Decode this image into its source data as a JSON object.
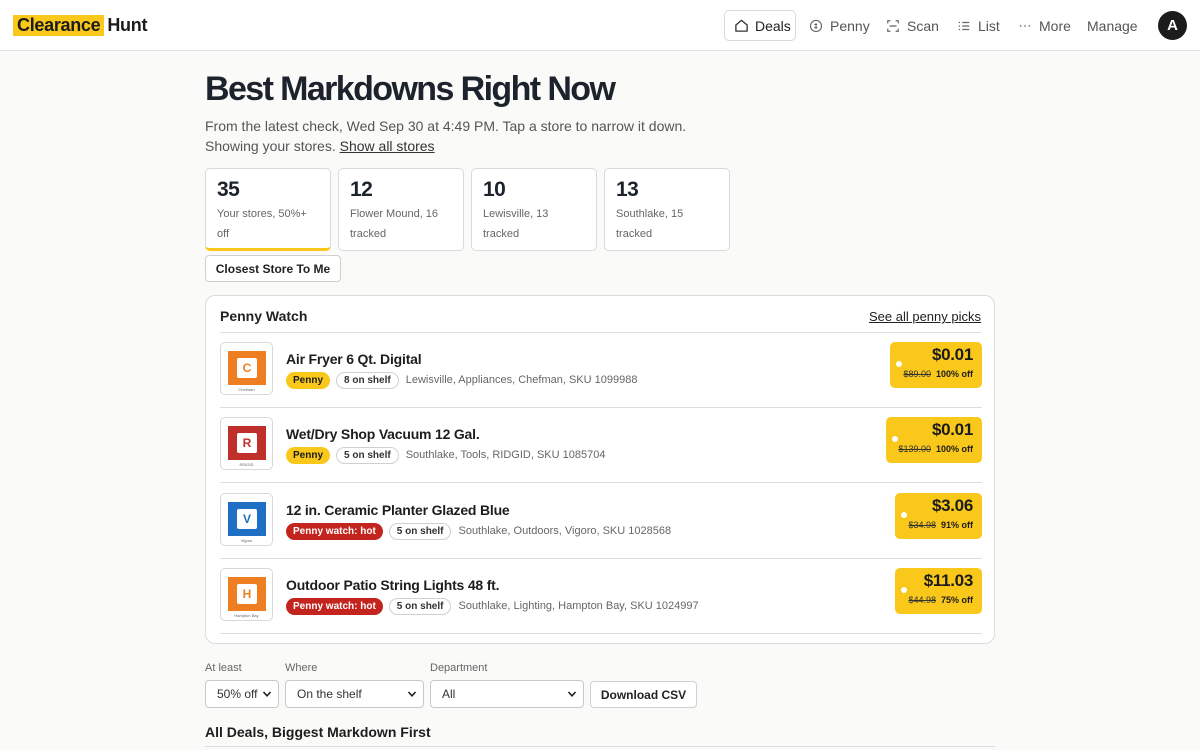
{
  "brand": {
    "highlight": "Clearance",
    "rest": "Hunt",
    "accent": "#f9c81b"
  },
  "nav": {
    "deals": "Deals",
    "penny": "Penny",
    "scan": "Scan",
    "list": "List",
    "more": "More",
    "manage": "Manage",
    "avatar": "A"
  },
  "header": {
    "title": "Best Markdowns Right Now",
    "subtitle": "From the latest check, Wed Sep 30 at 4:49 PM. Tap a store to narrow it down.",
    "showing": "Showing your stores.",
    "show_all_link": "Show all stores"
  },
  "stats": [
    {
      "value": "35",
      "label": "Your stores, 50%+ off"
    },
    {
      "value": "12",
      "label": "Flower Mound, 16 tracked"
    },
    {
      "value": "10",
      "label": "Lewisville, 13 tracked"
    },
    {
      "value": "13",
      "label": "Southlake, 15 tracked"
    }
  ],
  "closest_button": "Closest Store To Me",
  "penny_watch": {
    "title": "Penny Watch",
    "see_all": "See all penny picks",
    "items": [
      {
        "thumb_letter": "C",
        "thumb_caption": "Chefman",
        "thumb_color": "#ee7e22",
        "title": "Air Fryer 6 Qt. Digital",
        "badge": "Penny",
        "badge_type": "penny",
        "shelf": "8 on shelf",
        "meta": "Lewisville, Appliances, Chefman, SKU 1099988",
        "price": "$0.01",
        "was": "$89.00",
        "off": "100% off"
      },
      {
        "thumb_letter": "R",
        "thumb_caption": "RIDGID",
        "thumb_color": "#c0302b",
        "title": "Wet/Dry Shop Vacuum 12 Gal.",
        "badge": "Penny",
        "badge_type": "penny",
        "shelf": "5 on shelf",
        "meta": "Southlake, Tools, RIDGID, SKU 1085704",
        "price": "$0.01",
        "was": "$139.00",
        "off": "100% off"
      },
      {
        "thumb_letter": "V",
        "thumb_caption": "Vigoro",
        "thumb_color": "#1f6fc4",
        "title": "12 in. Ceramic Planter Glazed Blue",
        "badge": "Penny watch: hot",
        "badge_type": "hot",
        "shelf": "5 on shelf",
        "meta": "Southlake, Outdoors, Vigoro, SKU 1028568",
        "price": "$3.06",
        "was": "$34.98",
        "off": "91% off"
      },
      {
        "thumb_letter": "H",
        "thumb_caption": "Hampton Bay",
        "thumb_color": "#ee7e22",
        "title": "Outdoor Patio String Lights 48 ft.",
        "badge": "Penny watch: hot",
        "badge_type": "hot",
        "shelf": "5 on shelf",
        "meta": "Southlake, Lighting, Hampton Bay, SKU 1024997",
        "price": "$11.03",
        "was": "$44.98",
        "off": "75% off"
      }
    ]
  },
  "filters": {
    "at_least_label": "At least",
    "at_least_value": "50% off",
    "where_label": "Where",
    "where_value": "On the shelf",
    "department_label": "Department",
    "department_value": "All",
    "download": "Download CSV"
  },
  "all_deals_title": "All Deals, Biggest Markdown First"
}
